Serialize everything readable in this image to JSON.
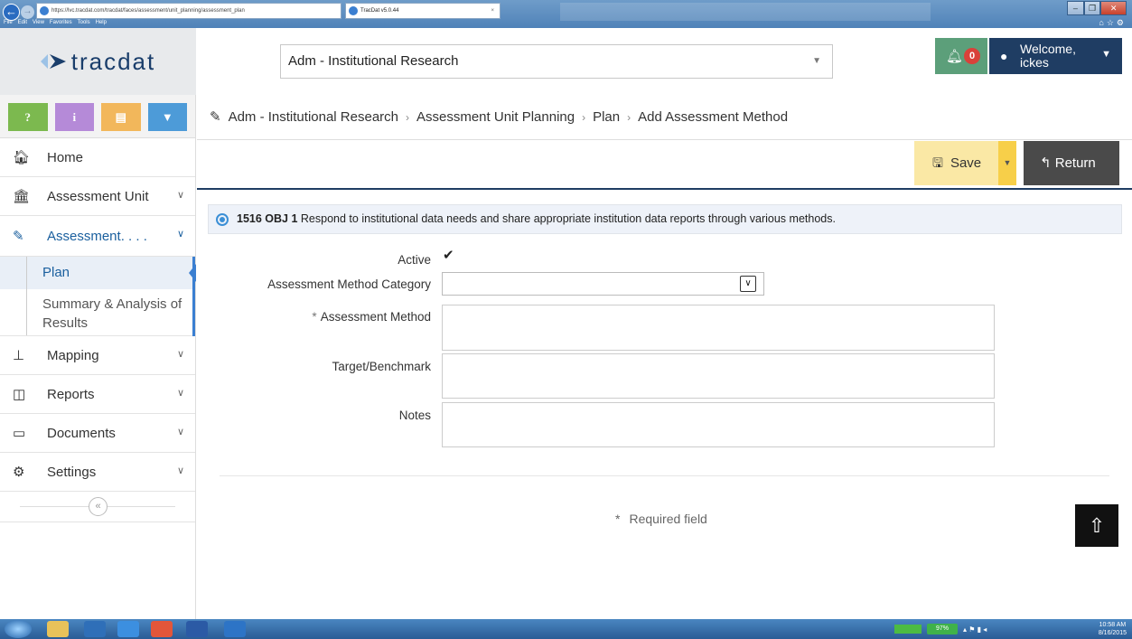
{
  "browser": {
    "url": "https://lvc.tracdat.com/tracdat/faces/assessment/unit_planning/assessment_plan",
    "tab_title": "TracDat v5.0.44",
    "menu": [
      "File",
      "Edit",
      "View",
      "Favorites",
      "Tools",
      "Help"
    ]
  },
  "header": {
    "logo_text": "tracdat",
    "unit_selected": "Adm - Institutional Research",
    "notification_count": "0",
    "welcome": "Welcome,",
    "username": "ickes"
  },
  "sidebar": {
    "quick_buttons": [
      "?",
      "i",
      "▤",
      "▼"
    ],
    "items": [
      {
        "label": "Home",
        "icon": "home-icon"
      },
      {
        "label": "Assessment Unit",
        "icon": "institution-icon"
      },
      {
        "label": "Assessment. . . .",
        "icon": "pencil-icon"
      },
      {
        "label": "Mapping",
        "icon": "sitemap-icon"
      },
      {
        "label": "Reports",
        "icon": "columns-icon"
      },
      {
        "label": "Documents",
        "icon": "folder-icon"
      },
      {
        "label": "Settings",
        "icon": "gear-icon"
      }
    ],
    "sub_items": [
      "Plan",
      "Summary & Analysis of Results"
    ]
  },
  "breadcrumb": [
    "Adm - Institutional Research",
    "Assessment Unit Planning",
    "Plan",
    "Add Assessment Method"
  ],
  "toolbar": {
    "save_label": "Save",
    "return_label": "Return"
  },
  "objective": {
    "code": "1516 OBJ 1",
    "text": "Respond to institutional data needs and share appropriate institution data reports through various methods."
  },
  "form": {
    "active_label": "Active",
    "active_checked": true,
    "category_label": "Assessment Method Category",
    "category_value": "",
    "method_label": "Assessment Method",
    "target_label": "Target/Benchmark",
    "notes_label": "Notes",
    "required_note": "Required field"
  },
  "taskbar": {
    "battery": "97%",
    "time": "10:58 AM",
    "date": "8/16/2015"
  },
  "colors": {
    "navy": "#1f3d63",
    "accent_blue": "#3b7fd1",
    "save_yellow": "#fae8a5",
    "notif_green": "#5c9f7a",
    "badge_red": "#d9413a"
  }
}
